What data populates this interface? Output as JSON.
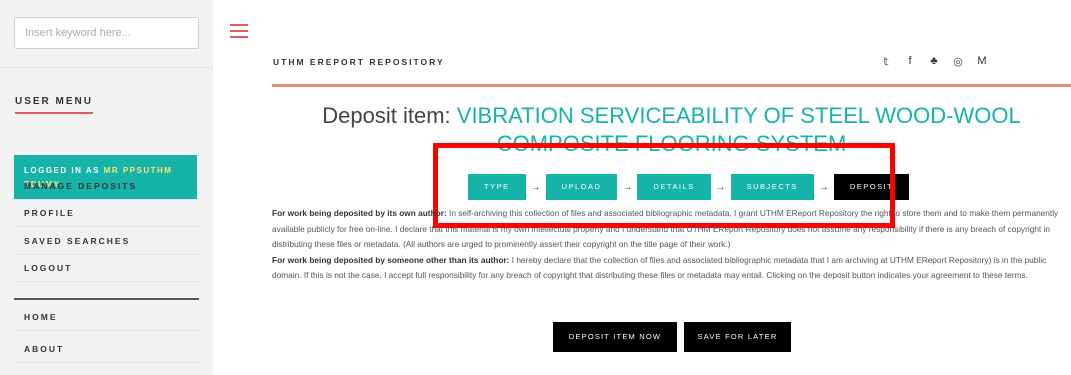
{
  "search": {
    "placeholder": "Insert keyword here..."
  },
  "sidebar": {
    "menu_title": "USER MENU",
    "logged_in_prefix": "LOGGED IN AS",
    "logged_in_user": "MR PPSUTHM EDUMY",
    "items": [
      {
        "label": "MANAGE DEPOSITS"
      },
      {
        "label": "PROFILE"
      },
      {
        "label": "SAVED SEARCHES"
      },
      {
        "label": "LOGOUT"
      },
      {
        "label": "HOME"
      },
      {
        "label": "ABOUT"
      }
    ]
  },
  "header": {
    "site_title": "UTHM EREPORT REPOSITORY",
    "socials": [
      {
        "icon": "twitter-icon",
        "glyph": "𝕥"
      },
      {
        "icon": "facebook-icon",
        "glyph": "f"
      },
      {
        "icon": "snapchat-icon",
        "glyph": "♣"
      },
      {
        "icon": "instagram-icon",
        "glyph": "◎"
      },
      {
        "icon": "mendeley-icon",
        "glyph": "M"
      }
    ],
    "accent_color": "#e25c5c"
  },
  "page": {
    "title_prefix": "Deposit item:",
    "item_title": "VIBRATION SERVICEABILITY OF STEEL WOOD-WOOL COMPOSITE FLOORING SYSTEM"
  },
  "steps": [
    {
      "label": "TYPE",
      "active": false
    },
    {
      "label": "UPLOAD",
      "active": false
    },
    {
      "label": "DETAILS",
      "active": false
    },
    {
      "label": "SUBJECTS",
      "active": false
    },
    {
      "label": "DEPOSIT",
      "active": true
    }
  ],
  "legal": {
    "own_heading": "For work being deposited by its own author:",
    "own_text": " In self-archiving this collection of files and associated bibliographic metadata, I grant UTHM EReport Repository the right to store them and to make them permanently available publicly for free on-line. I declare that this material is my own intellectual property and I understand that UTHM EReport Repository does not assume any responsibility if there is any breach of copyright in distributing these files or metadata. (All authors are urged to prominently assert their copyright on the title page of their work.)",
    "other_heading": "For work being deposited by someone other than its author:",
    "other_text": " I hereby declare that the collection of files and associated bibliographic metadata that I am archiving at UTHM EReport Repository) is in the public domain. If this is not the case, I accept full responsibility for any breach of copyright that distributing these files or metadata may entail. Clicking on the deposit button indicates your agreement to these terms."
  },
  "actions": {
    "deposit_now": "DEPOSIT ITEM NOW",
    "save_later": "SAVE FOR LATER"
  },
  "colors": {
    "teal": "#16b3a8",
    "active_step": "#000000",
    "highlight": "#ff0000"
  }
}
